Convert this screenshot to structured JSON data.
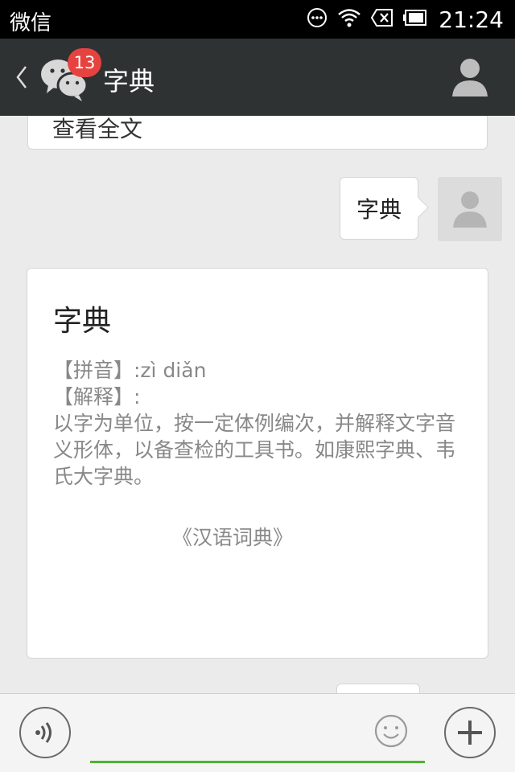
{
  "status_bar": {
    "app_label": "微信",
    "time": "21:24"
  },
  "title_bar": {
    "unread_badge": "13",
    "title": "字典"
  },
  "chat": {
    "partial_card_text": "查看全文",
    "my_message": "字典",
    "dict_card": {
      "title": "字典",
      "lines": [
        "【拼音】:zì diǎn",
        "【解释】:",
        "以字为单位，按一定体例编次，并解释文字音义形体，以备查检的工具书。如康熙字典、韦氏大字典。"
      ],
      "source": "《汉语词典》"
    }
  },
  "input_bar": {
    "placeholder": ""
  },
  "colors": {
    "title_bar_bg": "#2e3232",
    "badge": "#e64340",
    "input_underline": "#4db431",
    "chat_bg": "#ebebeb"
  }
}
